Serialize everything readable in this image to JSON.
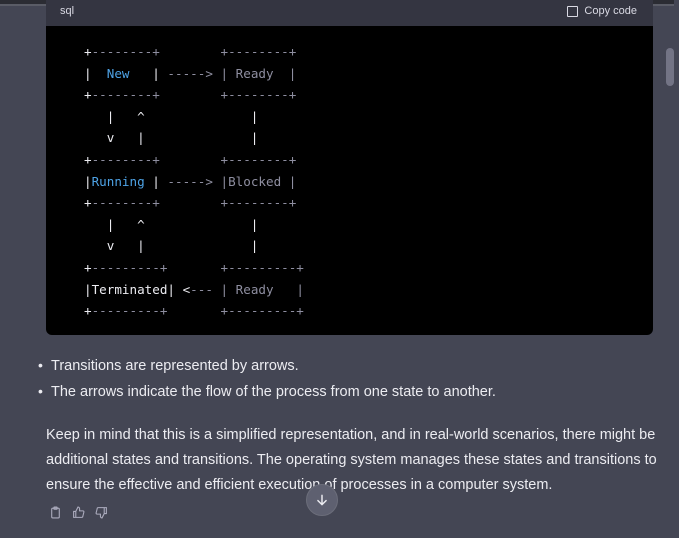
{
  "code_block": {
    "language": "sql",
    "copy_label": "Copy code",
    "lines": [
      {
        "segments": [
          {
            "t": "+",
            "c": ""
          },
          {
            "t": "--------",
            "c": "dim"
          },
          {
            "t": "+        ",
            "c": "dim"
          },
          {
            "t": "+--------+",
            "c": "dim"
          }
        ]
      },
      {
        "segments": [
          {
            "t": "|  ",
            "c": ""
          },
          {
            "t": "New",
            "c": "kw"
          },
          {
            "t": "   | ",
            "c": ""
          },
          {
            "t": "-----> ",
            "c": "dim"
          },
          {
            "t": "| Ready  |",
            "c": "dim"
          }
        ]
      },
      {
        "segments": [
          {
            "t": "+",
            "c": ""
          },
          {
            "t": "--------+        +--------+",
            "c": "dim"
          }
        ]
      },
      {
        "segments": [
          {
            "t": "   |   ^              |",
            "c": ""
          }
        ]
      },
      {
        "segments": [
          {
            "t": "   v   |              |",
            "c": ""
          }
        ]
      },
      {
        "segments": [
          {
            "t": "+",
            "c": ""
          },
          {
            "t": "--------+        +--------+",
            "c": "dim"
          }
        ]
      },
      {
        "segments": [
          {
            "t": "|",
            "c": ""
          },
          {
            "t": "Running",
            "c": "kw"
          },
          {
            "t": " | ",
            "c": ""
          },
          {
            "t": "-----> ",
            "c": "dim"
          },
          {
            "t": "|Blocked |",
            "c": "dim"
          }
        ]
      },
      {
        "segments": [
          {
            "t": "+",
            "c": ""
          },
          {
            "t": "--------+        +--------+",
            "c": "dim"
          }
        ]
      },
      {
        "segments": [
          {
            "t": "   |   ^              |",
            "c": ""
          }
        ]
      },
      {
        "segments": [
          {
            "t": "   v   |              |",
            "c": ""
          }
        ]
      },
      {
        "segments": [
          {
            "t": "+",
            "c": ""
          },
          {
            "t": "---------+       +---------+",
            "c": "dim"
          }
        ]
      },
      {
        "segments": [
          {
            "t": "|Terminated| <",
            "c": ""
          },
          {
            "t": "--- ",
            "c": "dim"
          },
          {
            "t": "| Ready   |",
            "c": "dim"
          }
        ]
      },
      {
        "segments": [
          {
            "t": "+",
            "c": ""
          },
          {
            "t": "---------+       +---------+",
            "c": "dim"
          }
        ]
      }
    ]
  },
  "bullets": [
    "Transitions are represented by arrows.",
    "The arrows indicate the flow of the process from one state to another."
  ],
  "paragraph": "Keep in mind that this is a simplified representation, and in real-world scenarios, there might be additional states and transitions. The operating system manages these states and transitions to ensure the effective and efficient execution of processes in a computer system.",
  "icons": {
    "copy": "clipboard-icon",
    "thumbs_up": "thumbs-up-icon",
    "thumbs_down": "thumbs-down-icon",
    "scroll_down": "arrow-down-icon"
  },
  "colors": {
    "background": "#444654",
    "code_bg": "#000000",
    "keyword": "#4ea3e6"
  }
}
